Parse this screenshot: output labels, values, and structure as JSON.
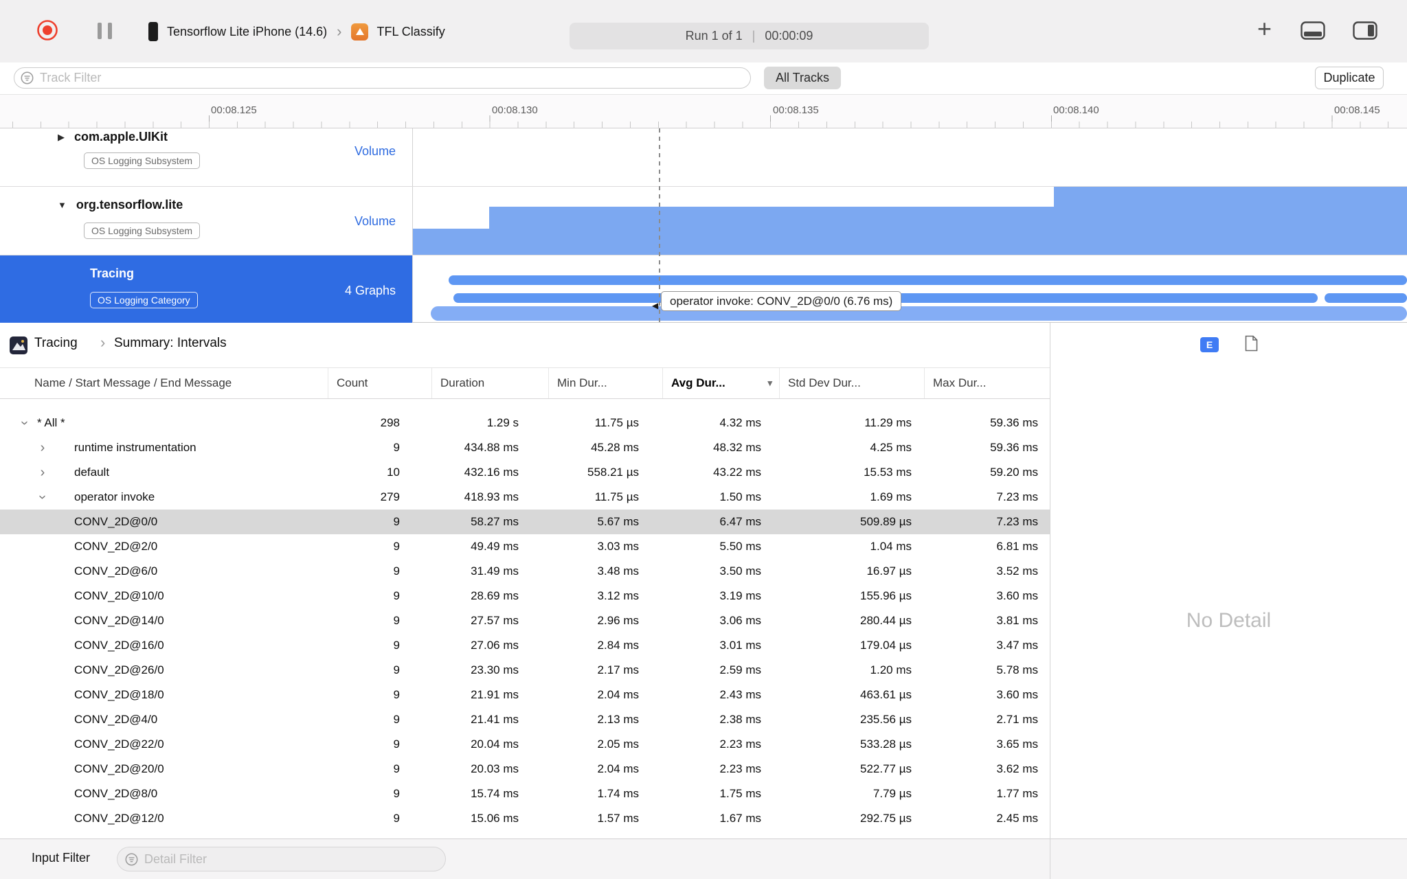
{
  "toolbar": {
    "device": "Tensorflow Lite iPhone (14.6)",
    "app_name": "TFL Classify",
    "run_label": "Run 1 of 1",
    "divider": "|",
    "elapsed": "00:00:09"
  },
  "filter_bar": {
    "track_filter_placeholder": "Track Filter",
    "all_tracks": "All Tracks",
    "duplicate": "Duplicate"
  },
  "timeline": {
    "labels": [
      "00:08.125",
      "00:08.130",
      "00:08.135",
      "00:08.140",
      "00:08.145"
    ]
  },
  "tracks": [
    {
      "name": "com.apple.UIKit",
      "badge": "OS Logging Subsystem",
      "meta": "Volume",
      "disclosure": "collapsed"
    },
    {
      "name": "org.tensorflow.lite",
      "badge": "OS Logging Subsystem",
      "meta": "Volume",
      "disclosure": "expanded"
    },
    {
      "name": "Tracing",
      "badge": "OS Logging Category",
      "meta": "4 Graphs",
      "selected": true
    }
  ],
  "tooltip": {
    "text": "operator invoke: CONV_2D@0/0 (6.76 ms)"
  },
  "summary": {
    "breadcrumb_root": "Tracing",
    "breadcrumb_current": "Summary: Intervals",
    "e_badge": "E"
  },
  "detail_pane": {
    "empty_text": "No Detail"
  },
  "bottom_bar": {
    "input_filter_label": "Input Filter",
    "detail_filter_placeholder": "Detail Filter"
  },
  "table": {
    "columns": [
      "Name / Start Message / End Message",
      "Count",
      "Duration",
      "Min Dur...",
      "Avg Dur...",
      "Std Dev Dur...",
      "Max Dur..."
    ],
    "sorted_column": "Avg Dur...",
    "rows": [
      {
        "name": "* All *",
        "level": 0,
        "disclosure": "expanded",
        "selected": false,
        "values": [
          "298",
          "1.29 s",
          "11.75 µs",
          "4.32 ms",
          "11.29 ms",
          "59.36 ms"
        ]
      },
      {
        "name": "runtime instrumentation",
        "level": 1,
        "disclosure": "collapsed",
        "selected": false,
        "values": [
          "9",
          "434.88 ms",
          "45.28 ms",
          "48.32 ms",
          "4.25 ms",
          "59.36 ms"
        ]
      },
      {
        "name": "default",
        "level": 1,
        "disclosure": "collapsed",
        "selected": false,
        "values": [
          "10",
          "432.16 ms",
          "558.21 µs",
          "43.22 ms",
          "15.53 ms",
          "59.20 ms"
        ]
      },
      {
        "name": "operator invoke",
        "level": 1,
        "disclosure": "expanded",
        "selected": false,
        "values": [
          "279",
          "418.93 ms",
          "11.75 µs",
          "1.50 ms",
          "1.69 ms",
          "7.23 ms"
        ]
      },
      {
        "name": "CONV_2D@0/0",
        "level": 2,
        "disclosure": "none",
        "selected": true,
        "values": [
          "9",
          "58.27 ms",
          "5.67 ms",
          "6.47 ms",
          "509.89 µs",
          "7.23 ms"
        ]
      },
      {
        "name": "CONV_2D@2/0",
        "level": 2,
        "disclosure": "none",
        "selected": false,
        "values": [
          "9",
          "49.49 ms",
          "3.03 ms",
          "5.50 ms",
          "1.04 ms",
          "6.81 ms"
        ]
      },
      {
        "name": "CONV_2D@6/0",
        "level": 2,
        "disclosure": "none",
        "selected": false,
        "values": [
          "9",
          "31.49 ms",
          "3.48 ms",
          "3.50 ms",
          "16.97 µs",
          "3.52 ms"
        ]
      },
      {
        "name": "CONV_2D@10/0",
        "level": 2,
        "disclosure": "none",
        "selected": false,
        "values": [
          "9",
          "28.69 ms",
          "3.12 ms",
          "3.19 ms",
          "155.96 µs",
          "3.60 ms"
        ]
      },
      {
        "name": "CONV_2D@14/0",
        "level": 2,
        "disclosure": "none",
        "selected": false,
        "values": [
          "9",
          "27.57 ms",
          "2.96 ms",
          "3.06 ms",
          "280.44 µs",
          "3.81 ms"
        ]
      },
      {
        "name": "CONV_2D@16/0",
        "level": 2,
        "disclosure": "none",
        "selected": false,
        "values": [
          "9",
          "27.06 ms",
          "2.84 ms",
          "3.01 ms",
          "179.04 µs",
          "3.47 ms"
        ]
      },
      {
        "name": "CONV_2D@26/0",
        "level": 2,
        "disclosure": "none",
        "selected": false,
        "values": [
          "9",
          "23.30 ms",
          "2.17 ms",
          "2.59 ms",
          "1.20 ms",
          "5.78 ms"
        ]
      },
      {
        "name": "CONV_2D@18/0",
        "level": 2,
        "disclosure": "none",
        "selected": false,
        "values": [
          "9",
          "21.91 ms",
          "2.04 ms",
          "2.43 ms",
          "463.61 µs",
          "3.60 ms"
        ]
      },
      {
        "name": "CONV_2D@4/0",
        "level": 2,
        "disclosure": "none",
        "selected": false,
        "values": [
          "9",
          "21.41 ms",
          "2.13 ms",
          "2.38 ms",
          "235.56 µs",
          "2.71 ms"
        ]
      },
      {
        "name": "CONV_2D@22/0",
        "level": 2,
        "disclosure": "none",
        "selected": false,
        "values": [
          "9",
          "20.04 ms",
          "2.05 ms",
          "2.23 ms",
          "533.28 µs",
          "3.65 ms"
        ]
      },
      {
        "name": "CONV_2D@20/0",
        "level": 2,
        "disclosure": "none",
        "selected": false,
        "values": [
          "9",
          "20.03 ms",
          "2.04 ms",
          "2.23 ms",
          "522.77 µs",
          "3.62 ms"
        ]
      },
      {
        "name": "CONV_2D@8/0",
        "level": 2,
        "disclosure": "none",
        "selected": false,
        "values": [
          "9",
          "15.74 ms",
          "1.74 ms",
          "1.75 ms",
          "7.79 µs",
          "1.77 ms"
        ]
      },
      {
        "name": "CONV_2D@12/0",
        "level": 2,
        "disclosure": "none",
        "selected": false,
        "values": [
          "9",
          "15.06 ms",
          "1.57 ms",
          "1.67 ms",
          "292.75 µs",
          "2.45 ms"
        ]
      }
    ]
  },
  "colors": {
    "accent_blue": "#2f6ce3",
    "chart_blue": "#7ca8f1",
    "bar_blue": "#5e97f3",
    "record_red": "#ee402e",
    "selected_row_gray": "#d8d8d8"
  }
}
